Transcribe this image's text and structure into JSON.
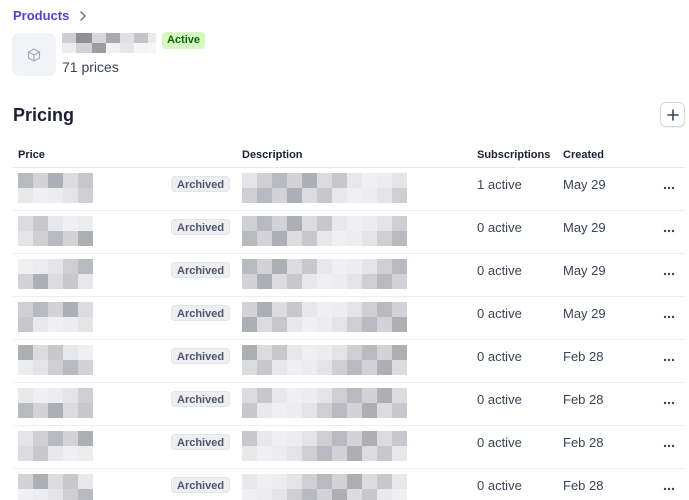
{
  "breadcrumb": {
    "products_label": "Products"
  },
  "product": {
    "status": "Active",
    "price_count": "71 prices"
  },
  "section": {
    "title": "Pricing"
  },
  "table": {
    "headers": {
      "price": "Price",
      "description": "Description",
      "subscriptions": "Subscriptions",
      "created": "Created"
    },
    "rows": [
      {
        "status": "Archived",
        "subscriptions": "1 active",
        "created": "May 29"
      },
      {
        "status": "Archived",
        "subscriptions": "0 active",
        "created": "May 29"
      },
      {
        "status": "Archived",
        "subscriptions": "0 active",
        "created": "May 29"
      },
      {
        "status": "Archived",
        "subscriptions": "0 active",
        "created": "May 29"
      },
      {
        "status": "Archived",
        "subscriptions": "0 active",
        "created": "Feb 28"
      },
      {
        "status": "Archived",
        "subscriptions": "0 active",
        "created": "Feb 28"
      },
      {
        "status": "Archived",
        "subscriptions": "0 active",
        "created": "Feb 28"
      },
      {
        "status": "Archived",
        "subscriptions": "0 active",
        "created": "Feb 28"
      }
    ]
  },
  "icons": {
    "breadcrumb_chevron": "chevron-right-icon",
    "product": "cube-icon",
    "add": "plus-icon",
    "row_menu": "ellipsis-icon"
  },
  "colors": {
    "link": "#5b3bd6",
    "active_badge_bg": "#d7f7c2",
    "active_badge_text": "#05690d",
    "archived_badge_bg": "#eceef2"
  }
}
